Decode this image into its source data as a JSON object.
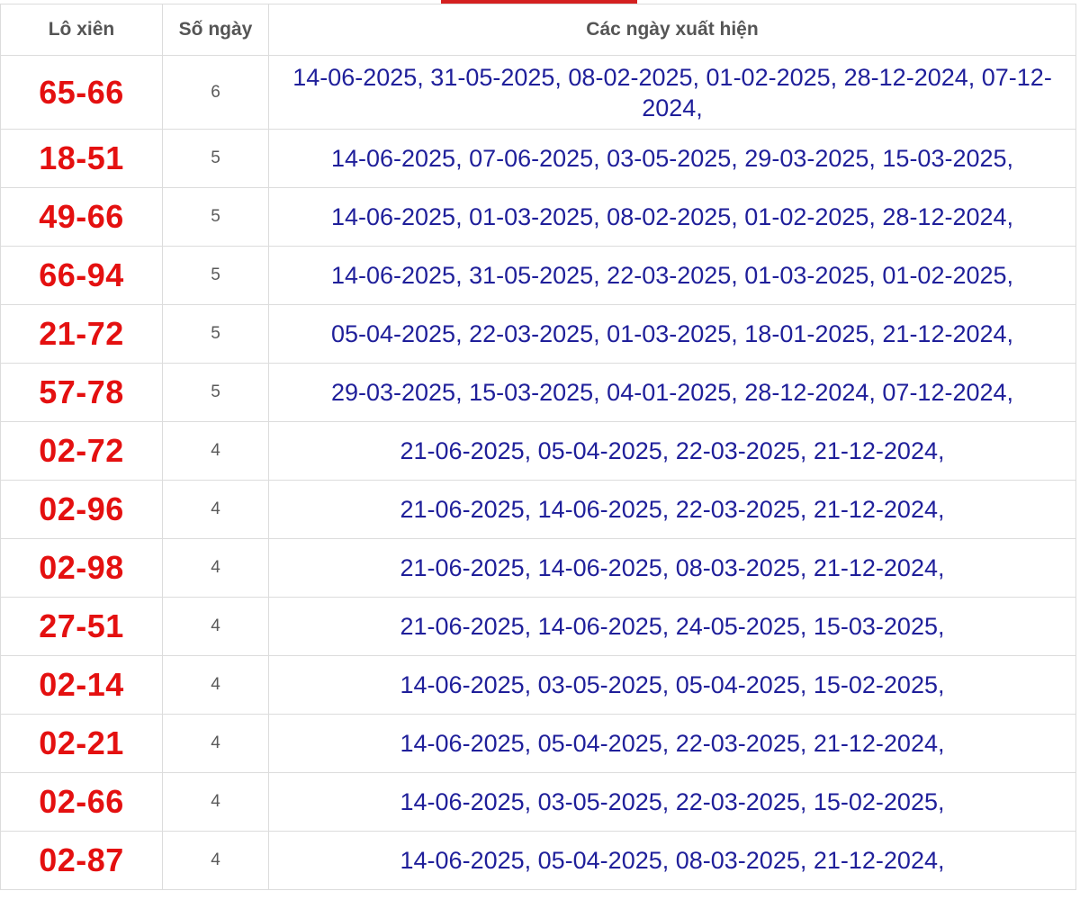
{
  "header": {
    "col_pair": "Lô xiên",
    "col_days": "Số ngày",
    "col_dates": "Các ngày xuất hiện"
  },
  "colors": {
    "accent": "#d42020",
    "pair_text": "#e41010",
    "dates_text": "#1f1f9a",
    "count_text": "#5a5a5a",
    "header_text": "#555555",
    "border": "#dcdcdc"
  },
  "rows": [
    {
      "pair": "65-66",
      "days": "6",
      "dates": "14-06-2025, 31-05-2025, 08-02-2025, 01-02-2025, 28-12-2024, 07-12-2024,"
    },
    {
      "pair": "18-51",
      "days": "5",
      "dates": "14-06-2025, 07-06-2025, 03-05-2025, 29-03-2025, 15-03-2025,"
    },
    {
      "pair": "49-66",
      "days": "5",
      "dates": "14-06-2025, 01-03-2025, 08-02-2025, 01-02-2025, 28-12-2024,"
    },
    {
      "pair": "66-94",
      "days": "5",
      "dates": "14-06-2025, 31-05-2025, 22-03-2025, 01-03-2025, 01-02-2025,"
    },
    {
      "pair": "21-72",
      "days": "5",
      "dates": "05-04-2025, 22-03-2025, 01-03-2025, 18-01-2025, 21-12-2024,"
    },
    {
      "pair": "57-78",
      "days": "5",
      "dates": "29-03-2025, 15-03-2025, 04-01-2025, 28-12-2024, 07-12-2024,"
    },
    {
      "pair": "02-72",
      "days": "4",
      "dates": "21-06-2025, 05-04-2025, 22-03-2025, 21-12-2024,"
    },
    {
      "pair": "02-96",
      "days": "4",
      "dates": "21-06-2025, 14-06-2025, 22-03-2025, 21-12-2024,"
    },
    {
      "pair": "02-98",
      "days": "4",
      "dates": "21-06-2025, 14-06-2025, 08-03-2025, 21-12-2024,"
    },
    {
      "pair": "27-51",
      "days": "4",
      "dates": "21-06-2025, 14-06-2025, 24-05-2025, 15-03-2025,"
    },
    {
      "pair": "02-14",
      "days": "4",
      "dates": "14-06-2025, 03-05-2025, 05-04-2025, 15-02-2025,"
    },
    {
      "pair": "02-21",
      "days": "4",
      "dates": "14-06-2025, 05-04-2025, 22-03-2025, 21-12-2024,"
    },
    {
      "pair": "02-66",
      "days": "4",
      "dates": "14-06-2025, 03-05-2025, 22-03-2025, 15-02-2025,"
    },
    {
      "pair": "02-87",
      "days": "4",
      "dates": "14-06-2025, 05-04-2025, 08-03-2025, 21-12-2024,"
    }
  ]
}
